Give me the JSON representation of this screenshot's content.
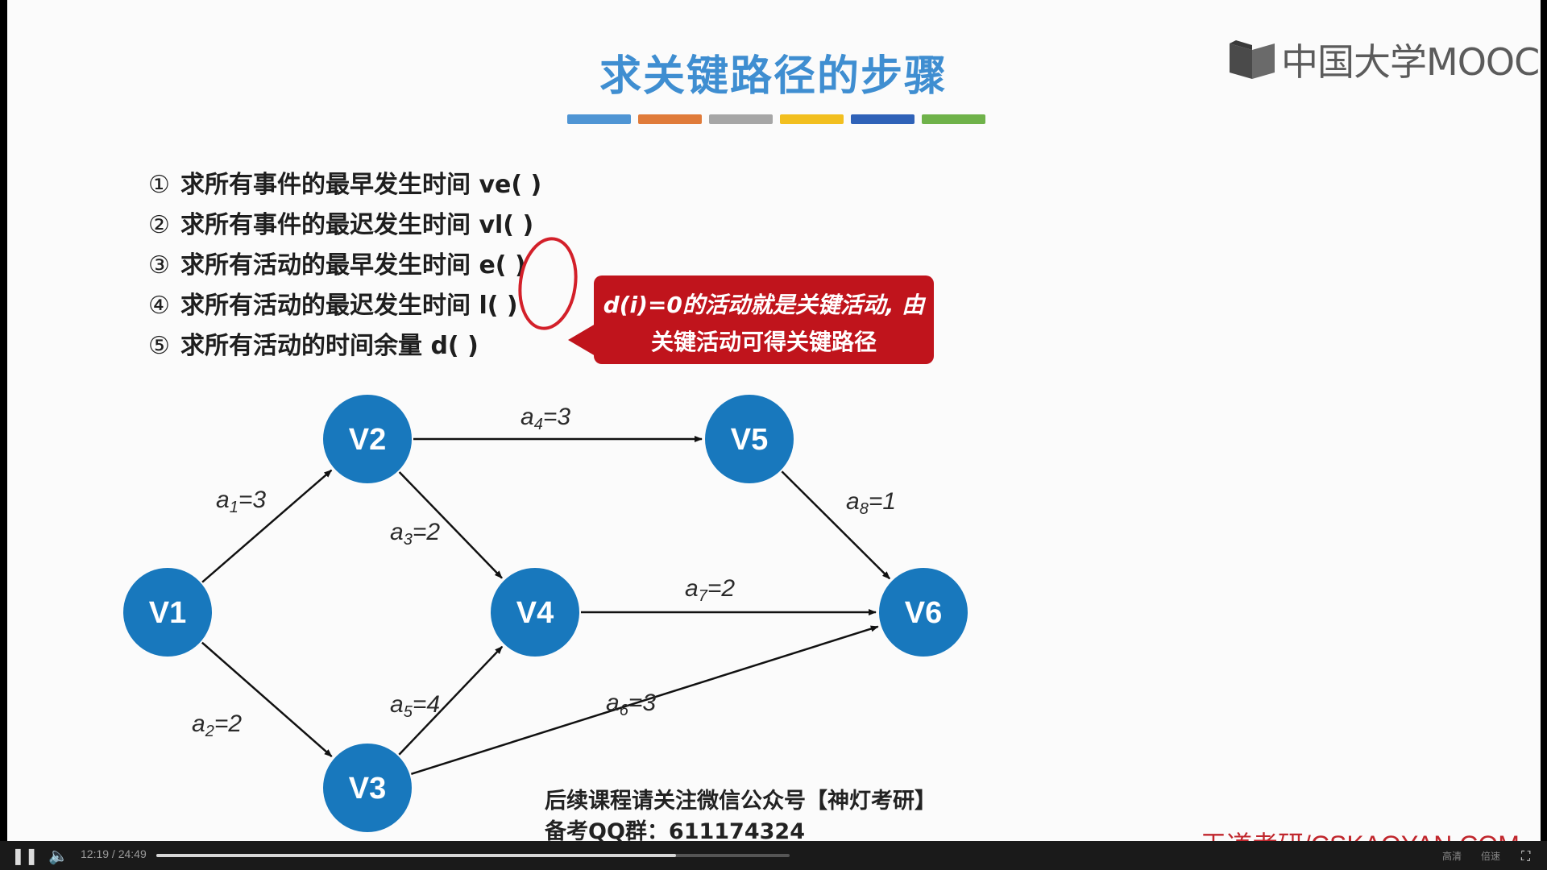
{
  "slide": {
    "title": "求关键路径的步骤",
    "color_bar": [
      "#4f95d4",
      "#e07b3a",
      "#a6a6a6",
      "#f2bf1f",
      "#2f62b8",
      "#6fb24a"
    ],
    "logo_text": "中国大学MOOC",
    "steps": [
      {
        "num": "①",
        "text": "求所有事件的最早发生时间 ve( )"
      },
      {
        "num": "②",
        "text": "求所有事件的最迟发生时间 vl( )"
      },
      {
        "num": "③",
        "text": "求所有活动的最早发生时间 e( )"
      },
      {
        "num": "④",
        "text": "求所有活动的最迟发生时间 l( )"
      },
      {
        "num": "⑤",
        "text": "求所有活动的时间余量 d( )"
      }
    ],
    "callout": {
      "line1": "d(i)=0的活动就是关键活动, 由",
      "line2": "关键活动可得关键路径"
    },
    "graph": {
      "node_color": "#1878bd",
      "nodes": [
        "V1",
        "V2",
        "V3",
        "V4",
        "V5",
        "V6"
      ],
      "edges": [
        {
          "from": "V1",
          "to": "V2",
          "label": "a1=3"
        },
        {
          "from": "V1",
          "to": "V3",
          "label": "a2=2"
        },
        {
          "from": "V2",
          "to": "V4",
          "label": "a3=2"
        },
        {
          "from": "V2",
          "to": "V5",
          "label": "a4=3"
        },
        {
          "from": "V3",
          "to": "V4",
          "label": "a5=4"
        },
        {
          "from": "V3",
          "to": "V6",
          "label": "a6=3"
        },
        {
          "from": "V4",
          "to": "V6",
          "label": "a7=2"
        },
        {
          "from": "V5",
          "to": "V6",
          "label": "a8=1"
        }
      ]
    },
    "footer_line1": "后续课程请关注微信公众号【神灯考研】",
    "footer_line2": "备考QQ群：611174324",
    "watermark": "王道考研/CSKAOYAN.COM",
    "highlight_color": "#d3202a"
  },
  "player": {
    "time": "12:19 / 24:49",
    "progress": 0.82,
    "right_labels": [
      "高清",
      "倍速"
    ]
  }
}
